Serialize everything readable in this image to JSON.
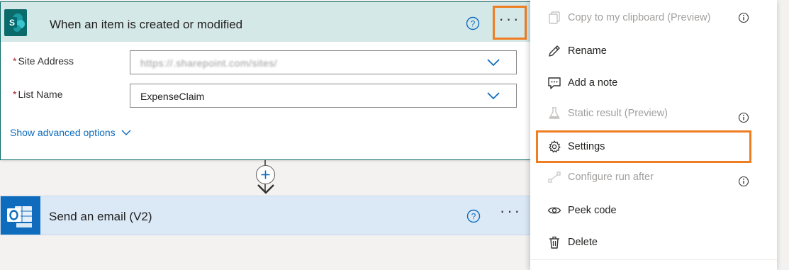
{
  "trigger_card": {
    "title": "When an item is created or modified",
    "fields": [
      {
        "label": "Site Address",
        "value": "https://.sharepoint.com/sites/"
      },
      {
        "label": "List Name",
        "value": "ExpenseClaim"
      }
    ],
    "required_mark": "*",
    "advanced_label": "Show advanced options"
  },
  "action_card": {
    "title": "Send an email (V2)"
  },
  "menu": {
    "items": [
      {
        "label": "Copy to my clipboard (Preview)",
        "icon": "copy-icon",
        "disabled": true,
        "info": true
      },
      {
        "label": "Rename",
        "icon": "pencil-icon",
        "disabled": false,
        "info": false
      },
      {
        "label": "Add a note",
        "icon": "note-icon",
        "disabled": false,
        "info": false
      },
      {
        "label": "Static result (Preview)",
        "icon": "flask-icon",
        "disabled": true,
        "info": true
      },
      {
        "label": "Settings",
        "icon": "gear-icon",
        "disabled": false,
        "info": false
      },
      {
        "label": "Configure run after",
        "icon": "run-after-icon",
        "disabled": true,
        "info": true
      },
      {
        "label": "Peek code",
        "icon": "eye-icon",
        "disabled": false,
        "info": false
      },
      {
        "label": "Delete",
        "icon": "trash-icon",
        "disabled": false,
        "info": false
      }
    ]
  },
  "colors": {
    "trigger_header": "#d4e8e7",
    "action_header": "#dbe9f7",
    "highlight": "#ef7d22",
    "link": "#0f6cbd",
    "sharepoint": "#03787c",
    "outlook": "#0f6cbd"
  }
}
